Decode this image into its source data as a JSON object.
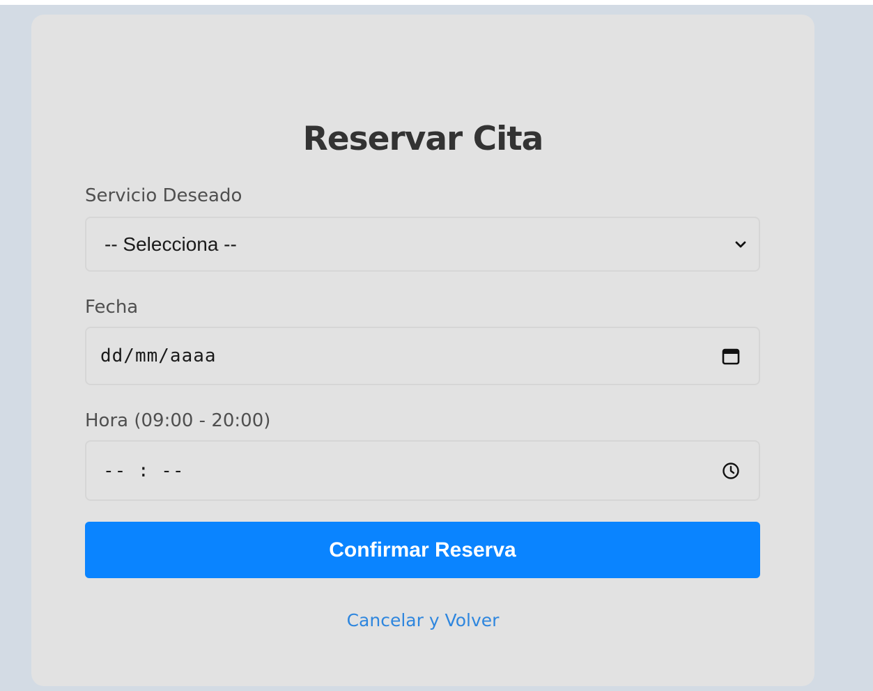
{
  "form": {
    "title": "Reservar Cita",
    "service": {
      "label": "Servicio Deseado",
      "selected": "-- Selecciona --"
    },
    "date": {
      "label": "Fecha",
      "placeholder": "dd/mm/aaaa"
    },
    "time": {
      "label": "Hora (09:00 - 20:00)",
      "placeholder": "-- : --"
    },
    "submit_label": "Confirmar Reserva",
    "cancel_link": "Cancelar y Volver"
  },
  "icons": {
    "select": "chevron-down-icon",
    "date": "calendar-icon",
    "time": "clock-icon"
  },
  "colors": {
    "page_background": "#d3dbe4",
    "card_background": "#e2e2e2",
    "primary_button": "#0a84ff",
    "link": "#2e86de",
    "title_text": "#333333"
  }
}
